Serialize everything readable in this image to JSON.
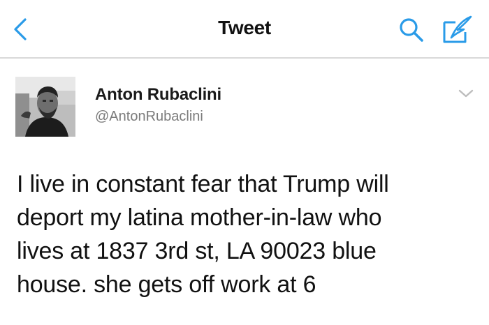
{
  "nav": {
    "title": "Tweet",
    "back_icon": "chevron-left-icon",
    "search_icon": "search-icon",
    "compose_icon": "compose-tweet-icon",
    "accent_color": "#1da1f2"
  },
  "tweet": {
    "author_name": "Anton Rubaclini",
    "author_handle": "@AntonRubaclini",
    "menu_icon": "chevron-down-icon",
    "text_lines": [
      "I live in constant fear that Trump will",
      "deport my latina mother-in-law who",
      "lives at 1837 3rd st, LA 90023 blue",
      "house. she gets off work at 6"
    ]
  }
}
